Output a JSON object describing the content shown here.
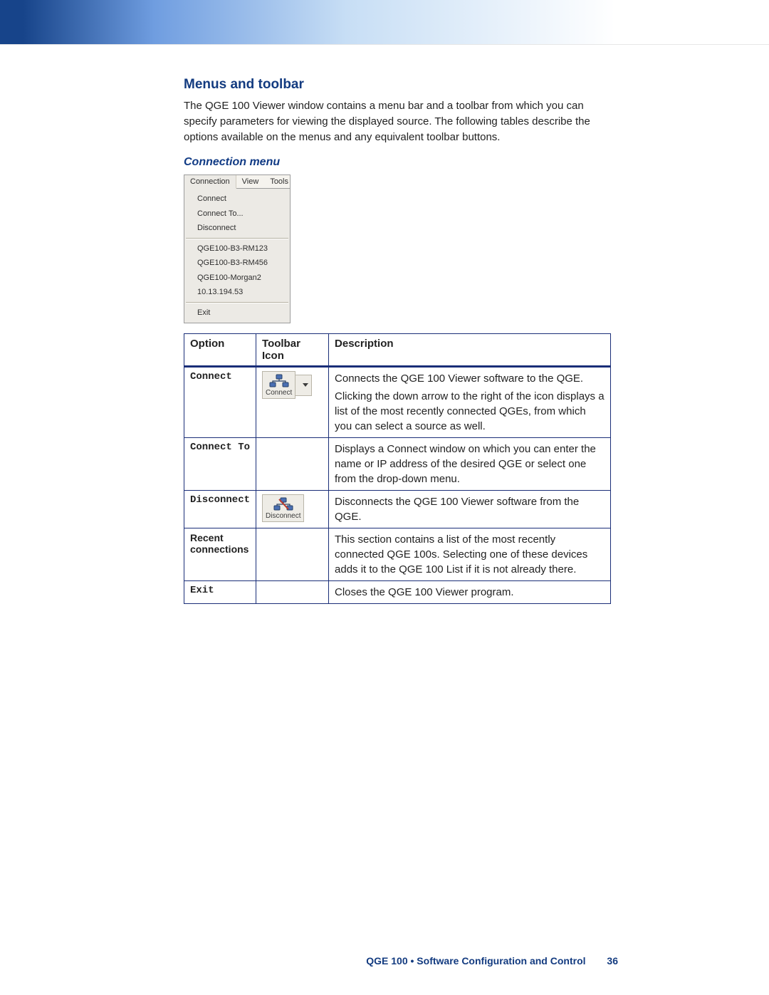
{
  "headings": {
    "section": "Menus and toolbar",
    "sub": "Connection menu"
  },
  "intro": "The QGE 100 Viewer window contains a menu bar and a toolbar from which you can specify parameters for viewing the displayed source. The following tables describe the options available on the menus and any equivalent toolbar buttons.",
  "menu_shot": {
    "menubar": [
      "Connection",
      "View",
      "Tools"
    ],
    "group1": [
      "Connect",
      "Connect To...",
      "Disconnect"
    ],
    "group2": [
      "QGE100-B3-RM123",
      "QGE100-B3-RM456",
      "QGE100-Morgan2",
      "10.13.194.53"
    ],
    "group3": [
      "Exit"
    ]
  },
  "table": {
    "headers": [
      "Option",
      "Toolbar Icon",
      "Description"
    ],
    "rows": [
      {
        "option": "Connect",
        "option_mono": true,
        "icon": "connect",
        "icon_label": "Connect",
        "desc": [
          "Connects the QGE 100 Viewer software to the QGE.",
          "Clicking the down arrow to the right of the icon displays a list of the most recently connected QGEs, from which you can select a source as well."
        ]
      },
      {
        "option": "Connect To",
        "option_mono": true,
        "icon": "",
        "desc": [
          "Displays a Connect window on which you can enter the name or IP address of the desired QGE or select one from the drop-down menu."
        ]
      },
      {
        "option": "Disconnect",
        "option_mono": true,
        "icon": "disconnect",
        "icon_label": "Disconnect",
        "desc": [
          "Disconnects the QGE 100 Viewer software from the QGE."
        ]
      },
      {
        "option": "Recent connections",
        "option_mono": false,
        "icon": "",
        "desc": [
          "This section contains a list of the most recently connected QGE 100s. Selecting one of these devices adds it to the QGE 100 List if it is not already there."
        ]
      },
      {
        "option": "Exit",
        "option_mono": true,
        "icon": "",
        "desc": [
          "Closes the QGE 100 Viewer program."
        ]
      }
    ]
  },
  "footer": {
    "text": "QGE 100 • Software Configuration and Control",
    "page": "36"
  }
}
